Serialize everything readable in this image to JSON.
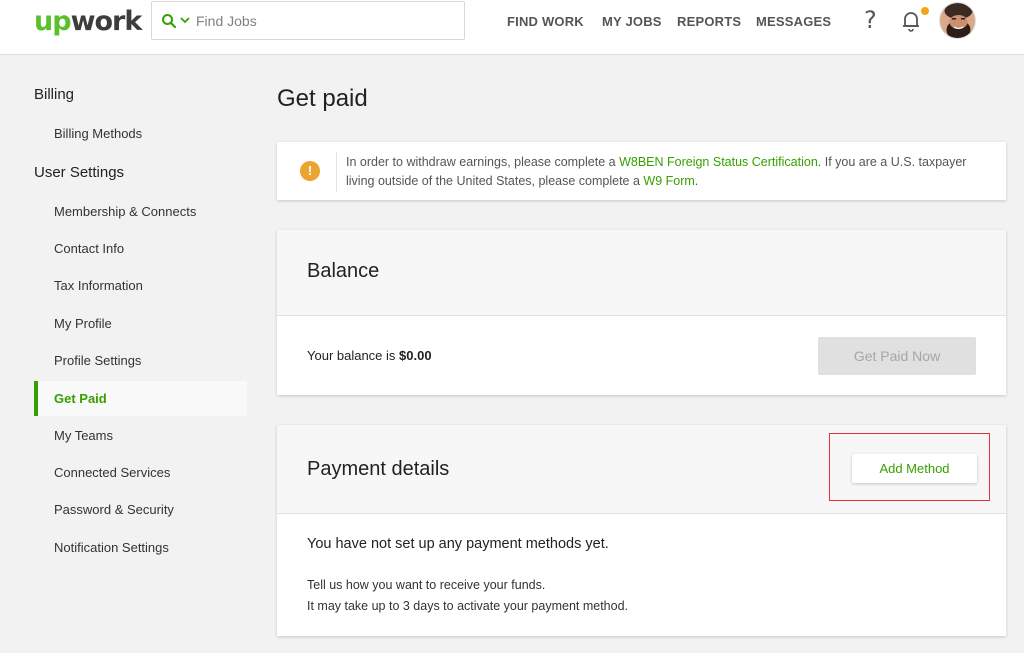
{
  "header": {
    "logo": {
      "part1": "up",
      "part2": "work"
    },
    "search": {
      "placeholder": "Find Jobs",
      "value": ""
    },
    "nav": [
      "FIND WORK",
      "MY JOBS",
      "REPORTS",
      "MESSAGES"
    ],
    "help_label": "?",
    "notification_dot_color": "#f3a41b"
  },
  "sidebar": {
    "sections": [
      {
        "title": "Billing",
        "items": [
          "Billing Methods"
        ]
      },
      {
        "title": "User Settings",
        "items": [
          "Membership & Connects",
          "Contact Info",
          "Tax Information",
          "My Profile",
          "Profile Settings",
          "Get Paid",
          "My Teams",
          "Connected Services",
          "Password & Security",
          "Notification Settings"
        ]
      }
    ],
    "active_item": "Get Paid"
  },
  "main": {
    "title": "Get paid",
    "alert": {
      "icon": "!",
      "text1": "In order to withdraw earnings, please complete a ",
      "link1": "W8BEN Foreign Status Certification",
      "text2": ". If you are a U.S. taxpayer living outside of the United States, please complete a ",
      "link2": "W9 Form",
      "text3": "."
    },
    "balance": {
      "title": "Balance",
      "label": "Your balance is ",
      "amount": "$0.00",
      "button": "Get Paid Now"
    },
    "payment": {
      "title": "Payment details",
      "add_button": "Add Method",
      "empty_message": "You have not set up any payment methods yet.",
      "help_lines": [
        "Tell us how you want to receive your funds.",
        "It may take up to 3 days to activate your payment method."
      ]
    }
  },
  "colors": {
    "brand_green": "#37a000",
    "logo_green": "#5ac12c",
    "warning": "#eba332",
    "highlight_red": "#e0333a"
  }
}
